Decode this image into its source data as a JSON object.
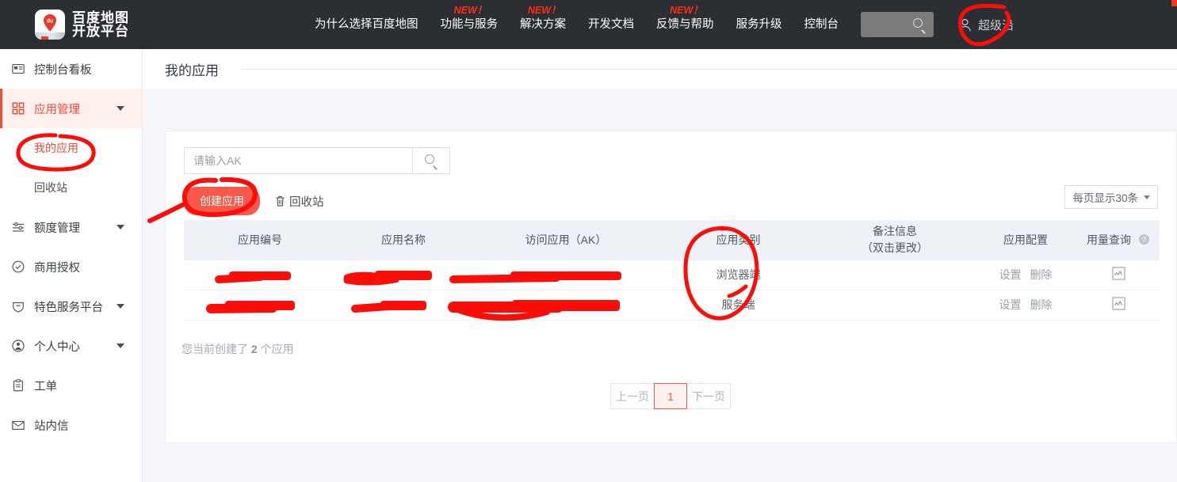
{
  "header": {
    "brand_line1": "百度地图",
    "brand_line2": "开放平台",
    "logo_text": "du",
    "nav": [
      {
        "label": "为什么选择百度地图",
        "badge": ""
      },
      {
        "label": "功能与服务",
        "badge": "NEW！"
      },
      {
        "label": "解决方案",
        "badge": "NEW！"
      },
      {
        "label": "开发文档",
        "badge": ""
      },
      {
        "label": "反馈与帮助",
        "badge": "NEW！"
      },
      {
        "label": "服务升级",
        "badge": ""
      },
      {
        "label": "控制台",
        "badge": ""
      }
    ],
    "search_placeholder": "",
    "user_name": "超级沿"
  },
  "sidebar": {
    "items": [
      {
        "label": "控制台看板",
        "icon": "dashboard-icon",
        "expandable": false,
        "active": false
      },
      {
        "label": "应用管理",
        "icon": "grid-icon",
        "expandable": true,
        "active": true
      },
      {
        "label": "额度管理",
        "icon": "sliders-icon",
        "expandable": true,
        "active": false
      },
      {
        "label": "商用授权",
        "icon": "shield-check-icon",
        "expandable": false,
        "active": false
      },
      {
        "label": "特色服务平台",
        "icon": "shield-icon",
        "expandable": true,
        "active": false
      },
      {
        "label": "个人中心",
        "icon": "user-circle-icon",
        "expandable": true,
        "active": false
      },
      {
        "label": "工单",
        "icon": "clipboard-icon",
        "expandable": false,
        "active": false
      },
      {
        "label": "站内信",
        "icon": "envelope-icon",
        "expandable": false,
        "active": false
      }
    ],
    "sub_items": [
      {
        "label": "我的应用",
        "current": true
      },
      {
        "label": "回收站",
        "current": false
      }
    ]
  },
  "main": {
    "page_title": "我的应用",
    "search": {
      "value": "",
      "placeholder": "请输入AK"
    },
    "create_button": "创建应用",
    "recycle_link": "回收站",
    "page_size": "每页显示30条",
    "table": {
      "headers": [
        {
          "label": "应用编号",
          "sub": ""
        },
        {
          "label": "应用名称",
          "sub": ""
        },
        {
          "label": "访问应用（AK）",
          "sub": ""
        },
        {
          "label": "应用类别",
          "sub": ""
        },
        {
          "label": "备注信息",
          "sub": "（双击更改）"
        },
        {
          "label": "应用配置",
          "sub": ""
        },
        {
          "label": "用量查询",
          "sub": ""
        }
      ],
      "rows": [
        {
          "id": "",
          "name": "",
          "ak": "",
          "type": "浏览器端",
          "remark": "",
          "config_setting": "设置",
          "config_delete": "删除",
          "usage": "chart-icon"
        },
        {
          "id": "",
          "name": "",
          "ak": "",
          "type": "服务端",
          "remark": "",
          "config_setting": "设置",
          "config_delete": "删除",
          "usage": "chart-icon"
        }
      ]
    },
    "count_prefix": "您当前创建了",
    "count_value": "2",
    "count_suffix": "个应用",
    "pagination": {
      "prev": "上一页",
      "current": "1",
      "next": "下一页"
    }
  },
  "colors": {
    "nav_bg": "#2b2f33",
    "accent": "#f7594c",
    "annotation": "#fb0d0a",
    "new_badge": "#ff2d16"
  }
}
